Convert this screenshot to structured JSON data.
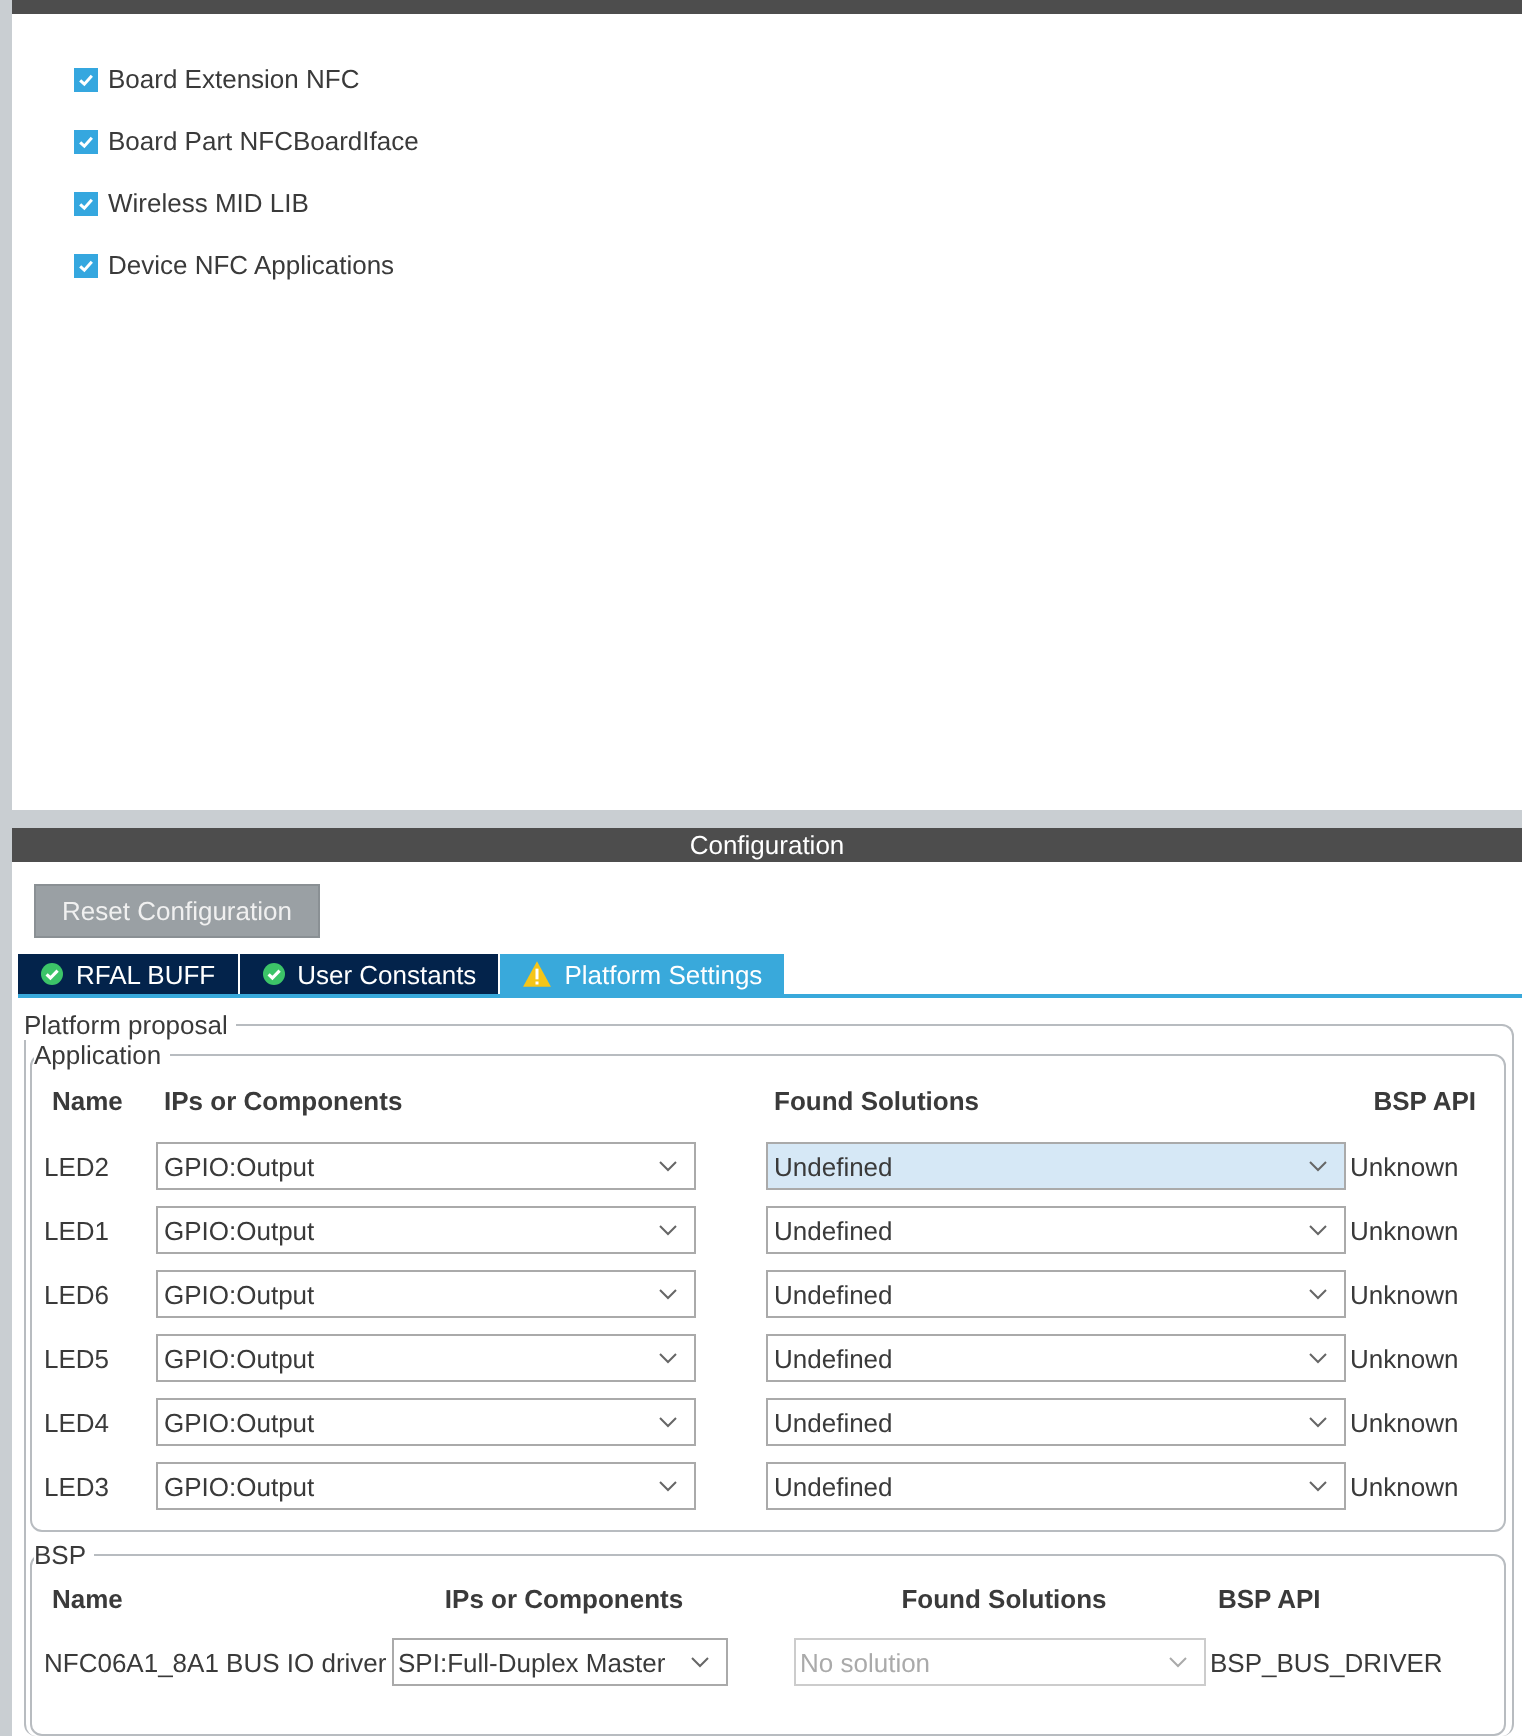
{
  "mode_panel": {
    "options": [
      {
        "label": "Board Extension NFC",
        "checked": true
      },
      {
        "label": "Board Part NFCBoardIface",
        "checked": true
      },
      {
        "label": "Wireless MID LIB",
        "checked": true
      },
      {
        "label": "Device NFC Applications",
        "checked": true
      }
    ]
  },
  "config_panel": {
    "title": "Configuration",
    "reset_button": "Reset Configuration",
    "tabs": [
      {
        "label": "RFAL BUFF",
        "kind": "ok",
        "selected": false
      },
      {
        "label": "User Constants",
        "kind": "ok",
        "selected": false
      },
      {
        "label": "Platform Settings",
        "kind": "warning",
        "selected": true
      }
    ],
    "proposal": {
      "title": "Platform proposal",
      "application": {
        "title": "Application",
        "columns": [
          "Name",
          "IPs or Components",
          "Found Solutions",
          "BSP API"
        ],
        "rows": [
          {
            "name": "LED2",
            "ip": "GPIO:Output",
            "solution": "Undefined",
            "solution_selected": true,
            "api": "Unknown"
          },
          {
            "name": "LED1",
            "ip": "GPIO:Output",
            "solution": "Undefined",
            "solution_selected": false,
            "api": "Unknown"
          },
          {
            "name": "LED6",
            "ip": "GPIO:Output",
            "solution": "Undefined",
            "solution_selected": false,
            "api": "Unknown"
          },
          {
            "name": "LED5",
            "ip": "GPIO:Output",
            "solution": "Undefined",
            "solution_selected": false,
            "api": "Unknown"
          },
          {
            "name": "LED4",
            "ip": "GPIO:Output",
            "solution": "Undefined",
            "solution_selected": false,
            "api": "Unknown"
          },
          {
            "name": "LED3",
            "ip": "GPIO:Output",
            "solution": "Undefined",
            "solution_selected": false,
            "api": "Unknown"
          }
        ]
      },
      "bsp": {
        "title": "BSP",
        "columns": [
          "Name",
          "IPs or Components",
          "Found Solutions",
          "BSP API"
        ],
        "rows": [
          {
            "name": "NFC06A1_8A1 BUS IO driver",
            "ip": "SPI:Full-Duplex Master",
            "solution": "No solution",
            "solution_disabled": true,
            "api": "BSP_BUS_DRIVER"
          }
        ]
      }
    }
  }
}
